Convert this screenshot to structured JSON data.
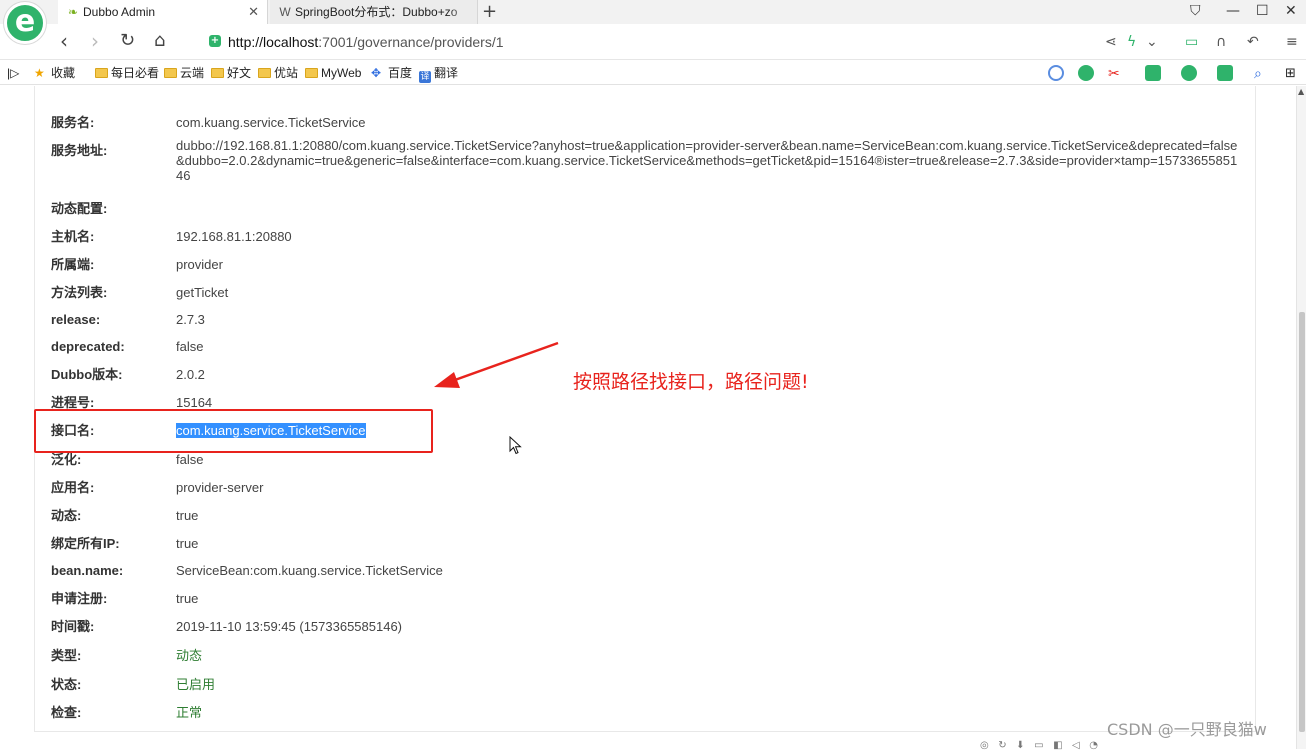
{
  "browser": {
    "tabs": [
      {
        "label": "Dubbo Admin",
        "active": true
      },
      {
        "label": "SpringBoot分布式：Dubbo+zo",
        "active": false
      }
    ],
    "new_tab": "+",
    "url_host": "http://localhost",
    "url_rest": ":7001/governance/providers/1"
  },
  "bookmarks": [
    {
      "label": "收藏",
      "icon": "star-icon"
    },
    {
      "label": "每日必看",
      "icon": "folder-icon"
    },
    {
      "label": "云端",
      "icon": "folder-icon"
    },
    {
      "label": "好文",
      "icon": "folder-icon"
    },
    {
      "label": "优站",
      "icon": "folder-icon"
    },
    {
      "label": "MyWeb",
      "icon": "folder-icon"
    },
    {
      "label": "百度",
      "icon": "paw-icon"
    },
    {
      "label": "翻译",
      "icon": "translate-icon"
    }
  ],
  "details": [
    {
      "key": "服务名:",
      "value": "com.kuang.service.TicketService"
    },
    {
      "key": "服务地址:",
      "value": "dubbo://192.168.81.1:20880/com.kuang.service.TicketService?anyhost=true&application=provider-server&bean.name=ServiceBean:com.kuang.service.TicketService&deprecated=false&dubbo=2.0.2&dynamic=true&generic=false&interface=com.kuang.service.TicketService&methods=getTicket&pid=15164®ister=true&release=2.7.3&side=provider×tamp=1573365585146"
    },
    {
      "key": "动态配置:",
      "value": ""
    },
    {
      "key": "主机名:",
      "value": "192.168.81.1:20880"
    },
    {
      "key": "所属端:",
      "value": "provider"
    },
    {
      "key": "方法列表:",
      "value": "getTicket"
    },
    {
      "key": "release:",
      "value": "2.7.3"
    },
    {
      "key": "deprecated:",
      "value": "false"
    },
    {
      "key": "Dubbo版本:",
      "value": "2.0.2"
    },
    {
      "key": "进程号:",
      "value": "15164"
    },
    {
      "key": "接口名:",
      "value": "com.kuang.service.TicketService"
    },
    {
      "key": "泛化:",
      "value": "false"
    },
    {
      "key": "应用名:",
      "value": "provider-server"
    },
    {
      "key": "动态:",
      "value": "true"
    },
    {
      "key": "绑定所有IP:",
      "value": "true"
    },
    {
      "key": "bean.name:",
      "value": "ServiceBean:com.kuang.service.TicketService"
    },
    {
      "key": "申请注册:",
      "value": "true"
    },
    {
      "key": "时间戳:",
      "value": "2019-11-10 13:59:45 (1573365585146)"
    },
    {
      "key": "类型:",
      "value": "动态"
    },
    {
      "key": "状态:",
      "value": "已启用"
    },
    {
      "key": "检查:",
      "value": "正常"
    }
  ],
  "annotation": {
    "text": "按照路径找接口，路径问题!",
    "color": "#e8231d"
  },
  "watermark": "CSDN @一只野良猫w",
  "colors": {
    "accent_green": "#2fb36b",
    "status_green": "#2e7d32",
    "selection": "#3390ff"
  }
}
